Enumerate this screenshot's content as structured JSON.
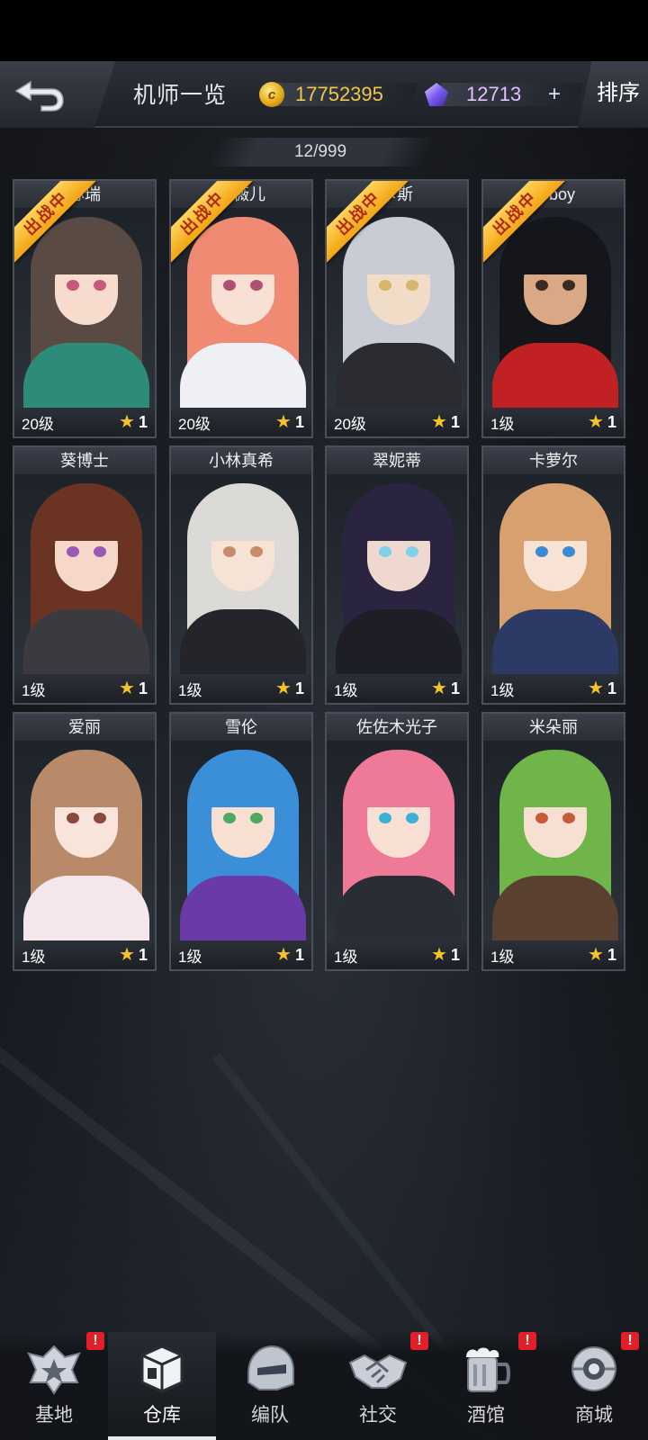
{
  "header": {
    "title": "机师一览",
    "coins": "17752395",
    "coin_icon": "coin-icon",
    "gems": "12713",
    "gem_icon": "crystal-icon",
    "plus": "+",
    "sort": "排序"
  },
  "count": "12/999",
  "badge_text": "出战中",
  "pilots": [
    {
      "name": "苏瑞",
      "level": "20级",
      "stars": "1",
      "deployed": true,
      "hair": "#5a4a44",
      "eye": "#c25a78",
      "outfit": "#2e8b7a",
      "skin": "#f7dccd"
    },
    {
      "name": "尼薇儿",
      "level": "20级",
      "stars": "1",
      "deployed": true,
      "hair": "#f08a72",
      "eye": "#b05070",
      "outfit": "#eef0f6",
      "skin": "#f9e0d4"
    },
    {
      "name": "卡斯",
      "level": "20级",
      "stars": "1",
      "deployed": true,
      "hair": "#c9ccd4",
      "eye": "#d6b66a",
      "outfit": "#2a2c31",
      "skin": "#f1dcc8"
    },
    {
      "name": "D-boy",
      "level": "1级",
      "stars": "1",
      "deployed": true,
      "hair": "#14161c",
      "eye": "#3b2a24",
      "outfit": "#c22124",
      "skin": "#d9a884"
    },
    {
      "name": "葵博士",
      "level": "1级",
      "stars": "1",
      "deployed": false,
      "hair": "#6b3324",
      "eye": "#9a5ab8",
      "outfit": "#3a3a40",
      "skin": "#f5d8c8"
    },
    {
      "name": "小林真希",
      "level": "1级",
      "stars": "1",
      "deployed": false,
      "hair": "#dcdad6",
      "eye": "#c98a6a",
      "outfit": "#24252b",
      "skin": "#f7e2d6"
    },
    {
      "name": "翠妮蒂",
      "level": "1级",
      "stars": "1",
      "deployed": false,
      "hair": "#2b2440",
      "eye": "#7fd0e8",
      "outfit": "#1e1e26",
      "skin": "#efd8d0"
    },
    {
      "name": "卡萝尔",
      "level": "1级",
      "stars": "1",
      "deployed": false,
      "hair": "#d8a06e",
      "eye": "#3a8ad6",
      "outfit": "#2d3a66",
      "skin": "#f8e2d4"
    },
    {
      "name": "爱丽",
      "level": "1级",
      "stars": "1",
      "deployed": false,
      "hair": "#b98a6a",
      "eye": "#8a4a3a",
      "outfit": "#f4e6ea",
      "skin": "#f8e4da"
    },
    {
      "name": "雪伦",
      "level": "1级",
      "stars": "1",
      "deployed": false,
      "hair": "#3b8ed8",
      "eye": "#4fa860",
      "outfit": "#6a3aa8",
      "skin": "#f7dfd2"
    },
    {
      "name": "佐佐木光子",
      "level": "1级",
      "stars": "1",
      "deployed": false,
      "hair": "#ef7a98",
      "eye": "#3ab0d8",
      "outfit": "#2a2c36",
      "skin": "#f8e0d4"
    },
    {
      "name": "米朵丽",
      "level": "1级",
      "stars": "1",
      "deployed": false,
      "hair": "#6fb54a",
      "eye": "#c85a3a",
      "outfit": "#5a4030",
      "skin": "#f6e0d2"
    }
  ],
  "nav": [
    {
      "label": "基地",
      "icon": "base-emblem-icon",
      "alert": true,
      "active": false
    },
    {
      "label": "仓库",
      "icon": "warehouse-box-icon",
      "alert": false,
      "active": true
    },
    {
      "label": "编队",
      "icon": "helmet-icon",
      "alert": false,
      "active": false
    },
    {
      "label": "社交",
      "icon": "handshake-icon",
      "alert": true,
      "active": false
    },
    {
      "label": "酒馆",
      "icon": "beer-mug-icon",
      "alert": true,
      "active": false
    },
    {
      "label": "商城",
      "icon": "shop-orb-icon",
      "alert": true,
      "active": false
    }
  ],
  "alert_mark": "!"
}
